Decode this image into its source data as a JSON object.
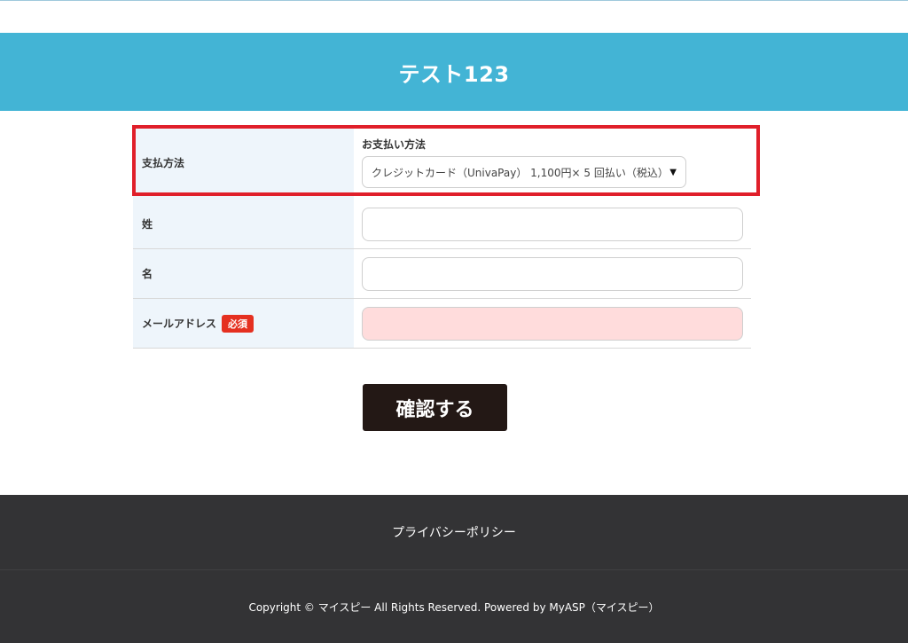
{
  "header": {
    "title": "テスト123"
  },
  "form": {
    "payment": {
      "label": "支払方法",
      "sublabel": "お支払い方法",
      "selected_option": "クレジットカード（UnivaPay） 1,100円× 5 回払い（税込）"
    },
    "last_name": {
      "label": "姓",
      "value": ""
    },
    "first_name": {
      "label": "名",
      "value": ""
    },
    "email": {
      "label": "メールアドレス",
      "required_badge": "必須",
      "value": ""
    }
  },
  "actions": {
    "confirm_label": "確認する"
  },
  "footer": {
    "privacy_link": "プライバシーポリシー",
    "copyright": "Copyright © マイスピー All Rights Reserved. Powered by MyASP（マイスピー）"
  },
  "colors": {
    "header_bg": "#43b4d5",
    "highlight": "#e01f2a",
    "required_badge": "#e53020",
    "required_input_bg": "#ffdcdc",
    "button_bg": "#231815",
    "footer_bg": "#333335"
  }
}
